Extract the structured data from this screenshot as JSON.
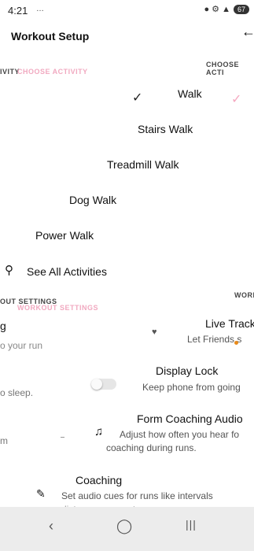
{
  "status_bar": {
    "time": "4:21",
    "note_icons": "…",
    "right_icons": "● ⚙ ▲",
    "battery": "67"
  },
  "header": {
    "title": "Workout Setup",
    "back_icon": "arrow-left-icon"
  },
  "activity": {
    "section_label_overlay": "CHOOSE ACTIVITY",
    "section_label_right": "CHOOSE ACTI",
    "section_label_left_cut": "IVITY",
    "items": [
      {
        "label": "Walk",
        "checked": true
      },
      {
        "label": "Stairs Walk"
      },
      {
        "label": "Treadmill Walk"
      },
      {
        "label": "Dog Walk"
      },
      {
        "label": "Power Walk"
      }
    ],
    "see_all": "See All Activities"
  },
  "settings": {
    "section_label_left": "OUT SETTINGS",
    "section_label_overlay": "WORKOUT SETTINGS",
    "section_label_right": "WORK",
    "live_tracking": {
      "title": "Live Track",
      "subtitle": "Let Friends s",
      "ghost_title": "g",
      "ghost_sub": "o your run"
    },
    "display_lock": {
      "title": "Display Lock",
      "subtitle": "Keep phone from going",
      "ghost_sub": "o sleep.",
      "toggle_on": false
    },
    "form_coaching": {
      "title": "Form Coaching Audio",
      "subtitle_1": "Adjust how often you hear fo",
      "subtitle_2": "coaching during runs.",
      "ghost": "m"
    },
    "coaching": {
      "title": "Coaching",
      "subtitle_1": "Set audio cues for runs like intervals",
      "subtitle_2": "distance, pace, etc."
    }
  },
  "nav": {
    "back": "‹",
    "home": "◯",
    "recents": "|||"
  }
}
